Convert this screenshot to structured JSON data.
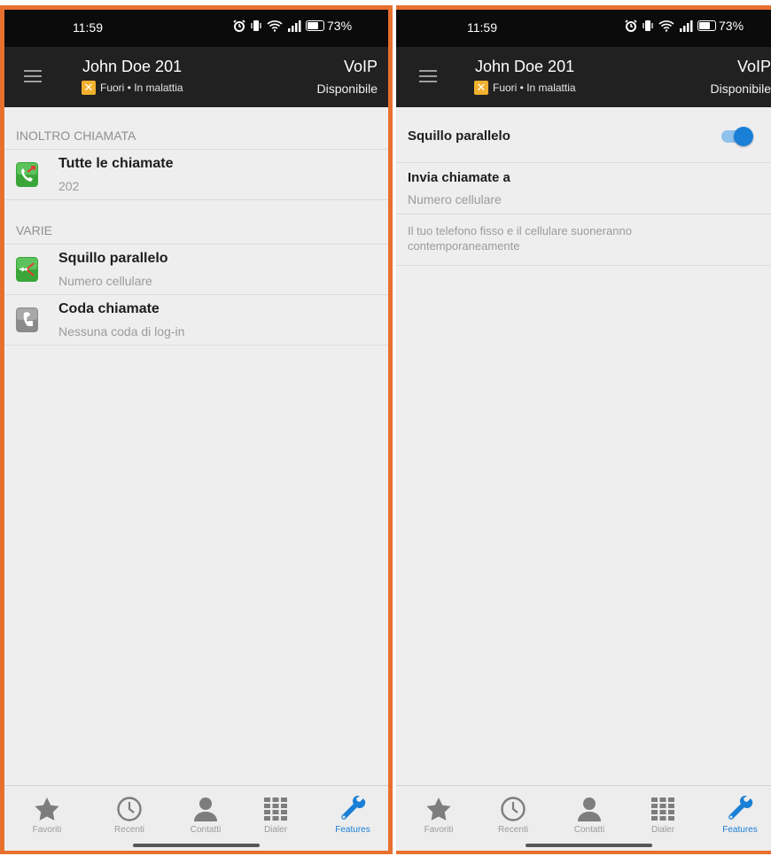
{
  "status_bar": {
    "time": "11:59",
    "battery": "73%",
    "battery_level": 0.73
  },
  "header": {
    "user_name": "John Doe 201",
    "presence": "Fuori • In malattia",
    "line_type": "VoIP",
    "availability": "Disponibile"
  },
  "left_screen": {
    "sections": [
      {
        "header": "INOLTRO CHIAMATA"
      },
      {
        "header": "VARIE"
      }
    ],
    "items": [
      {
        "title": "Tutte le chiamate",
        "subtitle": "202",
        "icon": "call-forward-icon"
      },
      {
        "title": "Squillo parallelo",
        "subtitle": "Numero cellulare",
        "icon": "parallel-ring-icon"
      },
      {
        "title": "Coda chiamate",
        "subtitle": "Nessuna coda di log-in",
        "icon": "call-queue-icon"
      }
    ]
  },
  "right_screen": {
    "toggle_label": "Squillo parallelo",
    "toggle_on": true,
    "send_calls_title": "Invia chiamate a",
    "send_calls_value": "Numero cellulare",
    "description": "Il tuo telefono fisso e il cellulare suoneranno contemporaneamente"
  },
  "bottom_nav": {
    "items": [
      {
        "label": "Favoriti",
        "icon": "star-icon"
      },
      {
        "label": "Recenti",
        "icon": "clock-icon"
      },
      {
        "label": "Contatti",
        "icon": "person-icon"
      },
      {
        "label": "Dialer",
        "icon": "dialpad-icon"
      },
      {
        "label": "Features",
        "icon": "wrench-icon"
      }
    ],
    "active": "Features"
  },
  "colors": {
    "frame_border": "#e8702e",
    "header_bg": "#212121",
    "accent": "#1a7fd6",
    "presence_badge": "#f1b02d"
  }
}
